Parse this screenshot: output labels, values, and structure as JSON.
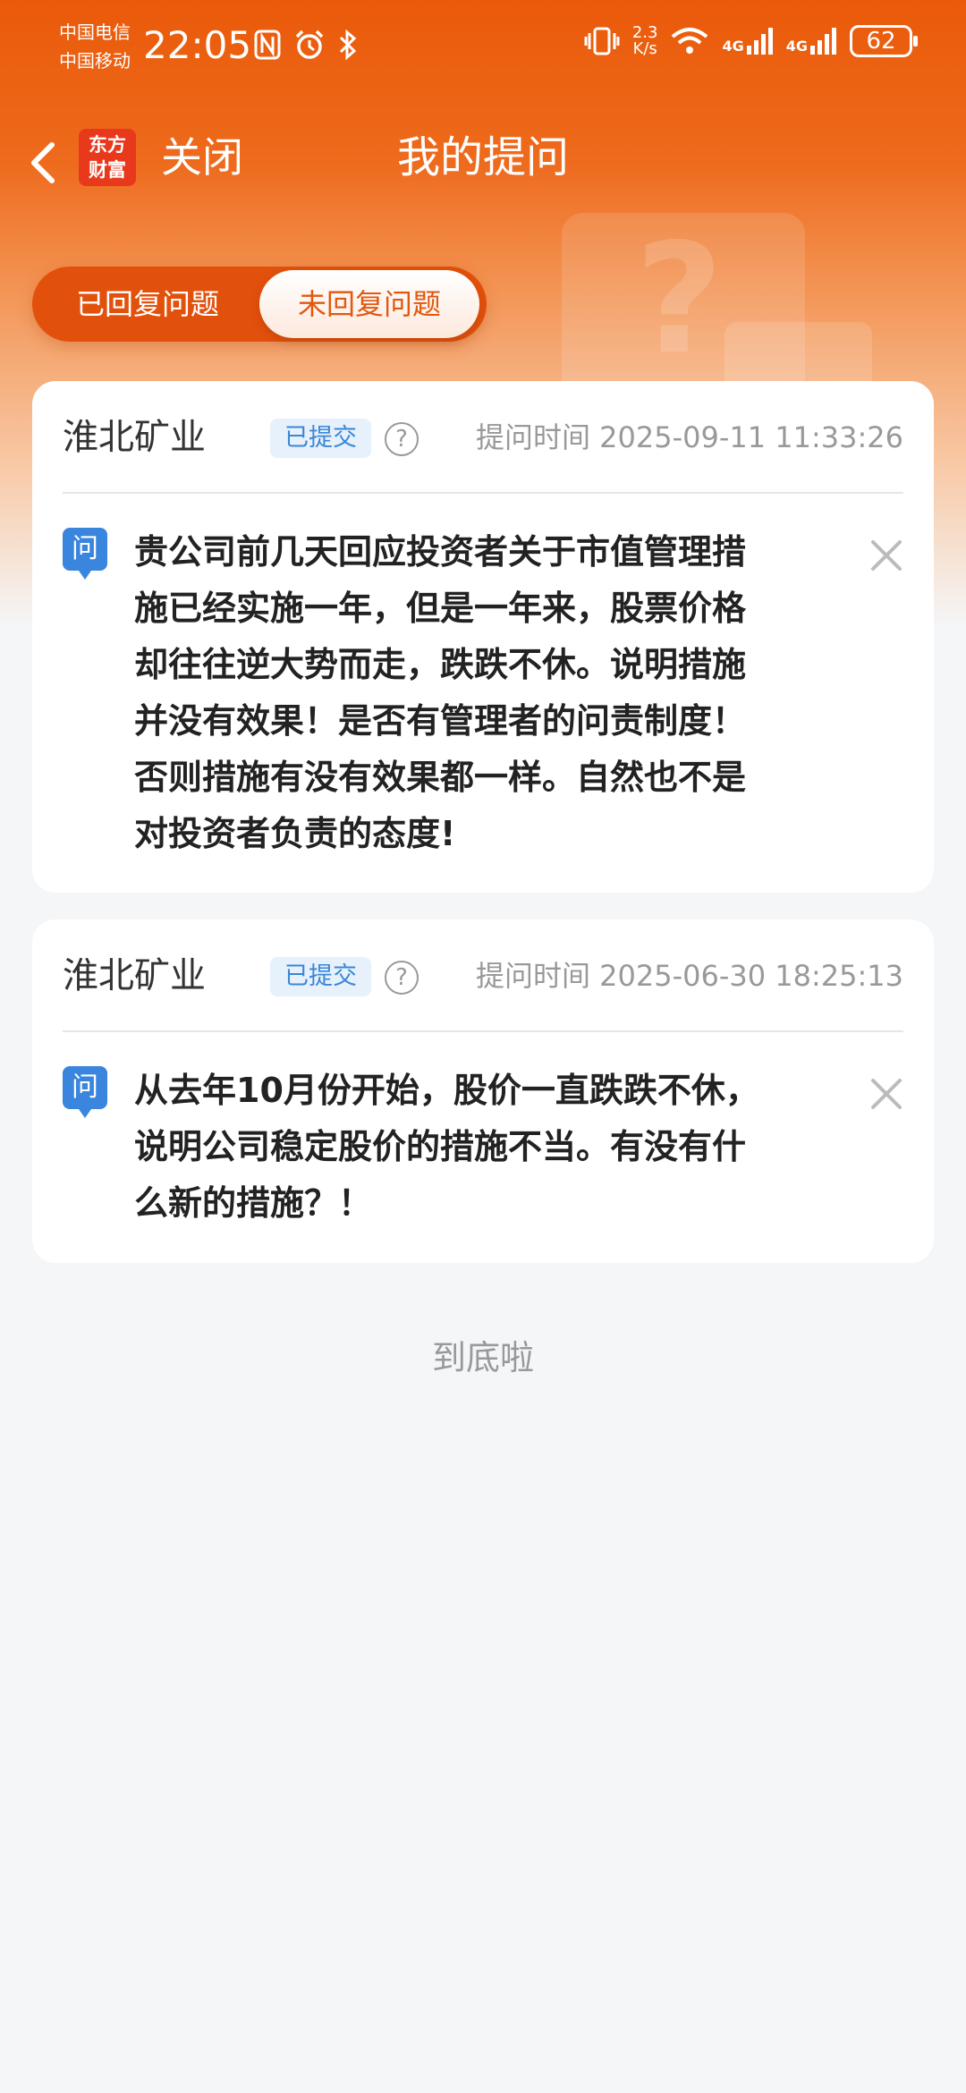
{
  "status_bar": {
    "carrier1": "中国电信",
    "carrier2": "中国移动",
    "time": "22:05",
    "net_speed_value": "2.3",
    "net_speed_unit": "K/s",
    "signal1_label": "4G",
    "signal2_label": "4G",
    "battery": "62"
  },
  "nav": {
    "logo_line1": "东方",
    "logo_line2": "财富",
    "close_label": "关闭",
    "title": "我的提问"
  },
  "tabs": [
    {
      "label": "已回复问题",
      "active": false
    },
    {
      "label": "未回复问题",
      "active": true
    }
  ],
  "questions": [
    {
      "company": "淮北矿业",
      "status": "已提交",
      "help_glyph": "?",
      "time": "提问时间 2025-09-11 11:33:26",
      "icon_label": "问",
      "lines": [
        "贵公司前几天回应投资者关于市值管理措",
        "施已经实施一年，但是一年来，股票价格",
        "却往往逆大势而走，跌跌不休。说明措施",
        "并没有效果！是否有管理者的问责制度！",
        "否则措施有没有效果都一样。自然也不是",
        "对投资者负责的态度!"
      ]
    },
    {
      "company": "淮北矿业",
      "status": "已提交",
      "help_glyph": "?",
      "time": "提问时间 2025-06-30 18:25:13",
      "icon_label": "问",
      "lines": [
        "从去年10月份开始，股价一直跌跌不休，",
        "说明公司稳定股价的措施不当。有没有什",
        "么新的措施？！"
      ]
    }
  ],
  "footer": {
    "end_text": "到底啦"
  },
  "colors": {
    "brand_orange": "#ea5a0a",
    "badge_blue": "#3b86d6",
    "question_icon_blue": "#3a85dd"
  }
}
